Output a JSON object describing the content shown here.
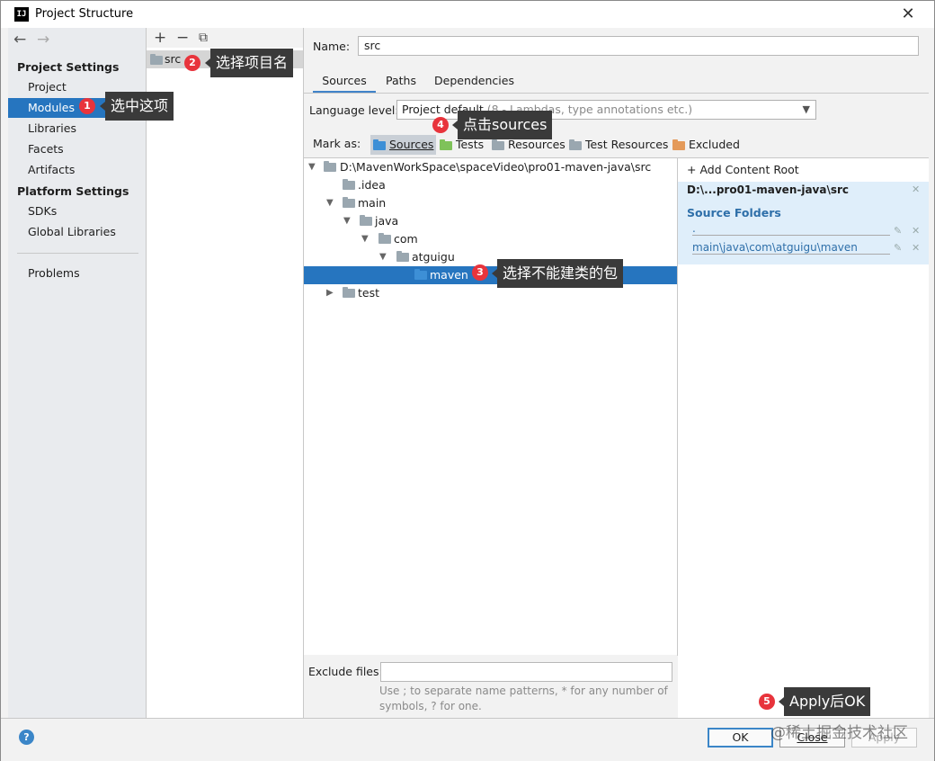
{
  "window": {
    "title": "Project Structure",
    "app_icon_text": "IJ",
    "close_glyph": "✕"
  },
  "nav": {
    "back_glyph": "←",
    "forward_glyph": "→",
    "project_settings_header": "Project Settings",
    "project_items": [
      "Project",
      "Modules",
      "Libraries",
      "Facets",
      "Artifacts"
    ],
    "selected_item": "Modules",
    "platform_settings_header": "Platform Settings",
    "platform_items": [
      "SDKs",
      "Global Libraries"
    ],
    "problems_label": "Problems"
  },
  "modules": {
    "toolbar": {
      "add_glyph": "+",
      "remove_glyph": "−",
      "copy_glyph": "⧉"
    },
    "items": [
      "src"
    ]
  },
  "main": {
    "name_label": "Name:",
    "name_value": "src",
    "tabs": [
      "Sources",
      "Paths",
      "Dependencies"
    ],
    "active_tab": "Sources",
    "language_level_label": "Language level:",
    "language_level_value": "Project default",
    "language_level_hint": " (8 - Lambdas, type annotations etc.)",
    "mark_as_label": "Mark as:",
    "mark_buttons": [
      "Sources",
      "Tests",
      "Resources",
      "Test Resources",
      "Excluded"
    ],
    "tree": [
      {
        "label": "D:\\MavenWorkSpace\\spaceVideo\\pro01-maven-java\\src",
        "depth": 0,
        "expanded": true
      },
      {
        "label": ".idea",
        "depth": 1,
        "expanded": null
      },
      {
        "label": "main",
        "depth": 1,
        "expanded": true
      },
      {
        "label": "java",
        "depth": 2,
        "expanded": true
      },
      {
        "label": "com",
        "depth": 3,
        "expanded": true
      },
      {
        "label": "atguigu",
        "depth": 4,
        "expanded": true
      },
      {
        "label": "maven",
        "depth": 5,
        "expanded": null,
        "selected": true
      },
      {
        "label": "test",
        "depth": 1,
        "expanded": false
      }
    ],
    "exclude_files_label": "Exclude files:",
    "exclude_files_value": "",
    "exclude_hint": "Use ; to separate name patterns, * for any number of symbols, ? for one."
  },
  "roots": {
    "add_content_root": "Add Content Root",
    "root_path": "D:\\...pro01-maven-java\\src",
    "source_folders_header": "Source Folders",
    "source_folders": [
      ".",
      "main\\java\\com\\atguigu\\maven"
    ]
  },
  "buttons": {
    "help": "?",
    "ok": "OK",
    "cancel": "Close",
    "apply": "Apply"
  },
  "annotations": [
    {
      "number": "1",
      "text": "选中这项"
    },
    {
      "number": "2",
      "text": "选择项目名"
    },
    {
      "number": "3",
      "text": "选择不能建类的包"
    },
    {
      "number": "4",
      "text": "点击sources"
    },
    {
      "number": "5",
      "text": "Apply后OK"
    }
  ],
  "watermark": "@稀土掘金技术社区",
  "colors": {
    "selection": "#2675bf",
    "badge": "#e8343c",
    "callout": "#3a3a3a",
    "source_folder_text": "#2e6fa9"
  }
}
